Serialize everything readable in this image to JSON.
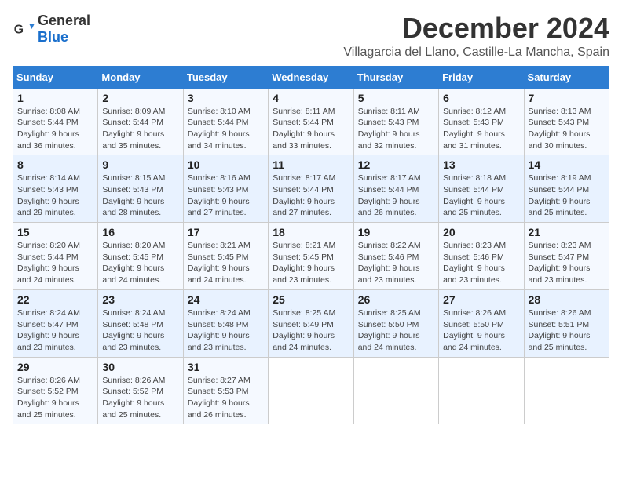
{
  "logo": {
    "general": "General",
    "blue": "Blue"
  },
  "title": "December 2024",
  "subtitle": "Villagarcia del Llano, Castille-La Mancha, Spain",
  "weekdays": [
    "Sunday",
    "Monday",
    "Tuesday",
    "Wednesday",
    "Thursday",
    "Friday",
    "Saturday"
  ],
  "weeks": [
    [
      {
        "day": "1",
        "sunrise": "8:08 AM",
        "sunset": "5:44 PM",
        "daylight": "9 hours and 36 minutes."
      },
      {
        "day": "2",
        "sunrise": "8:09 AM",
        "sunset": "5:44 PM",
        "daylight": "9 hours and 35 minutes."
      },
      {
        "day": "3",
        "sunrise": "8:10 AM",
        "sunset": "5:44 PM",
        "daylight": "9 hours and 34 minutes."
      },
      {
        "day": "4",
        "sunrise": "8:11 AM",
        "sunset": "5:44 PM",
        "daylight": "9 hours and 33 minutes."
      },
      {
        "day": "5",
        "sunrise": "8:11 AM",
        "sunset": "5:43 PM",
        "daylight": "9 hours and 32 minutes."
      },
      {
        "day": "6",
        "sunrise": "8:12 AM",
        "sunset": "5:43 PM",
        "daylight": "9 hours and 31 minutes."
      },
      {
        "day": "7",
        "sunrise": "8:13 AM",
        "sunset": "5:43 PM",
        "daylight": "9 hours and 30 minutes."
      }
    ],
    [
      {
        "day": "8",
        "sunrise": "8:14 AM",
        "sunset": "5:43 PM",
        "daylight": "9 hours and 29 minutes."
      },
      {
        "day": "9",
        "sunrise": "8:15 AM",
        "sunset": "5:43 PM",
        "daylight": "9 hours and 28 minutes."
      },
      {
        "day": "10",
        "sunrise": "8:16 AM",
        "sunset": "5:43 PM",
        "daylight": "9 hours and 27 minutes."
      },
      {
        "day": "11",
        "sunrise": "8:17 AM",
        "sunset": "5:44 PM",
        "daylight": "9 hours and 27 minutes."
      },
      {
        "day": "12",
        "sunrise": "8:17 AM",
        "sunset": "5:44 PM",
        "daylight": "9 hours and 26 minutes."
      },
      {
        "day": "13",
        "sunrise": "8:18 AM",
        "sunset": "5:44 PM",
        "daylight": "9 hours and 25 minutes."
      },
      {
        "day": "14",
        "sunrise": "8:19 AM",
        "sunset": "5:44 PM",
        "daylight": "9 hours and 25 minutes."
      }
    ],
    [
      {
        "day": "15",
        "sunrise": "8:20 AM",
        "sunset": "5:44 PM",
        "daylight": "9 hours and 24 minutes."
      },
      {
        "day": "16",
        "sunrise": "8:20 AM",
        "sunset": "5:45 PM",
        "daylight": "9 hours and 24 minutes."
      },
      {
        "day": "17",
        "sunrise": "8:21 AM",
        "sunset": "5:45 PM",
        "daylight": "9 hours and 24 minutes."
      },
      {
        "day": "18",
        "sunrise": "8:21 AM",
        "sunset": "5:45 PM",
        "daylight": "9 hours and 23 minutes."
      },
      {
        "day": "19",
        "sunrise": "8:22 AM",
        "sunset": "5:46 PM",
        "daylight": "9 hours and 23 minutes."
      },
      {
        "day": "20",
        "sunrise": "8:23 AM",
        "sunset": "5:46 PM",
        "daylight": "9 hours and 23 minutes."
      },
      {
        "day": "21",
        "sunrise": "8:23 AM",
        "sunset": "5:47 PM",
        "daylight": "9 hours and 23 minutes."
      }
    ],
    [
      {
        "day": "22",
        "sunrise": "8:24 AM",
        "sunset": "5:47 PM",
        "daylight": "9 hours and 23 minutes."
      },
      {
        "day": "23",
        "sunrise": "8:24 AM",
        "sunset": "5:48 PM",
        "daylight": "9 hours and 23 minutes."
      },
      {
        "day": "24",
        "sunrise": "8:24 AM",
        "sunset": "5:48 PM",
        "daylight": "9 hours and 23 minutes."
      },
      {
        "day": "25",
        "sunrise": "8:25 AM",
        "sunset": "5:49 PM",
        "daylight": "9 hours and 24 minutes."
      },
      {
        "day": "26",
        "sunrise": "8:25 AM",
        "sunset": "5:50 PM",
        "daylight": "9 hours and 24 minutes."
      },
      {
        "day": "27",
        "sunrise": "8:26 AM",
        "sunset": "5:50 PM",
        "daylight": "9 hours and 24 minutes."
      },
      {
        "day": "28",
        "sunrise": "8:26 AM",
        "sunset": "5:51 PM",
        "daylight": "9 hours and 25 minutes."
      }
    ],
    [
      {
        "day": "29",
        "sunrise": "8:26 AM",
        "sunset": "5:52 PM",
        "daylight": "9 hours and 25 minutes."
      },
      {
        "day": "30",
        "sunrise": "8:26 AM",
        "sunset": "5:52 PM",
        "daylight": "9 hours and 25 minutes."
      },
      {
        "day": "31",
        "sunrise": "8:27 AM",
        "sunset": "5:53 PM",
        "daylight": "9 hours and 26 minutes."
      },
      null,
      null,
      null,
      null
    ]
  ]
}
